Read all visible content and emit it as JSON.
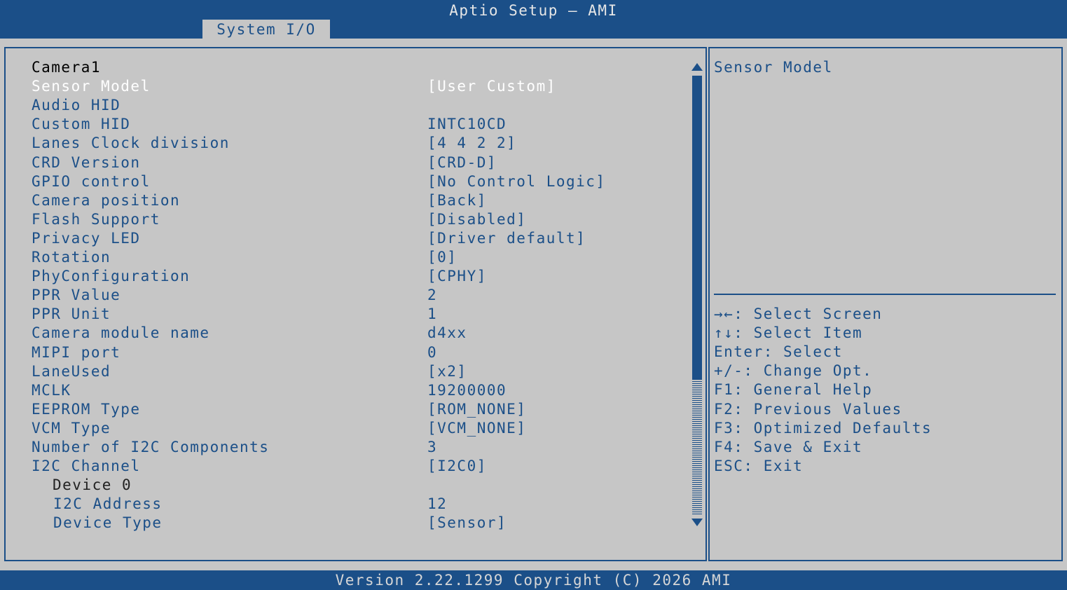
{
  "window": {
    "title": "Aptio Setup – AMI"
  },
  "tabs": [
    {
      "label": "System I/O"
    }
  ],
  "main": {
    "section_title": "Camera1",
    "settings": [
      {
        "label": "Sensor Model",
        "value": "[User Custom]"
      },
      {
        "label": "Audio HID",
        "value": ""
      },
      {
        "label": "Custom HID",
        "value": "INTC10CD"
      },
      {
        "label": "Lanes Clock division",
        "value": "[4 4 2 2]"
      },
      {
        "label": "CRD Version",
        "value": "[CRD-D]"
      },
      {
        "label": "GPIO control",
        "value": "[No Control Logic]"
      },
      {
        "label": "Camera position",
        "value": "[Back]"
      },
      {
        "label": "Flash Support",
        "value": "[Disabled]"
      },
      {
        "label": "Privacy LED",
        "value": "[Driver default]"
      },
      {
        "label": "Rotation",
        "value": "[0]"
      },
      {
        "label": "PhyConfiguration",
        "value": "[CPHY]"
      },
      {
        "label": "PPR Value",
        "value": "2"
      },
      {
        "label": "PPR Unit",
        "value": "1"
      },
      {
        "label": "Camera module name",
        "value": "d4xx"
      },
      {
        "label": "MIPI port",
        "value": "0"
      },
      {
        "label": "LaneUsed",
        "value": "[x2]"
      },
      {
        "label": "MCLK",
        "value": "19200000"
      },
      {
        "label": "EEPROM Type",
        "value": "[ROM_NONE]"
      },
      {
        "label": "VCM Type",
        "value": "[VCM_NONE]"
      },
      {
        "label": "Number of I2C Components",
        "value": "3"
      },
      {
        "label": "I2C Channel",
        "value": "[I2C0]"
      }
    ],
    "subsection_title": "Device 0",
    "device_settings": [
      {
        "label": "I2C Address",
        "value": "12"
      },
      {
        "label": "Device Type",
        "value": "[Sensor]"
      }
    ],
    "selected_index": 0
  },
  "help": {
    "title": "Sensor Model",
    "keys": [
      "→←: Select Screen",
      "↑↓: Select Item",
      "Enter: Select",
      "+/-: Change Opt.",
      "F1: General Help",
      "F2: Previous Values",
      "F3: Optimized Defaults",
      "F4: Save & Exit",
      "ESC: Exit"
    ]
  },
  "footer": {
    "text": "Version 2.22.1299 Copyright (C) 2026 AMI"
  },
  "colors": {
    "header_blue": "#1b4f88",
    "panel_gray": "#c6c6c6",
    "selected_text": "#ffffff"
  }
}
